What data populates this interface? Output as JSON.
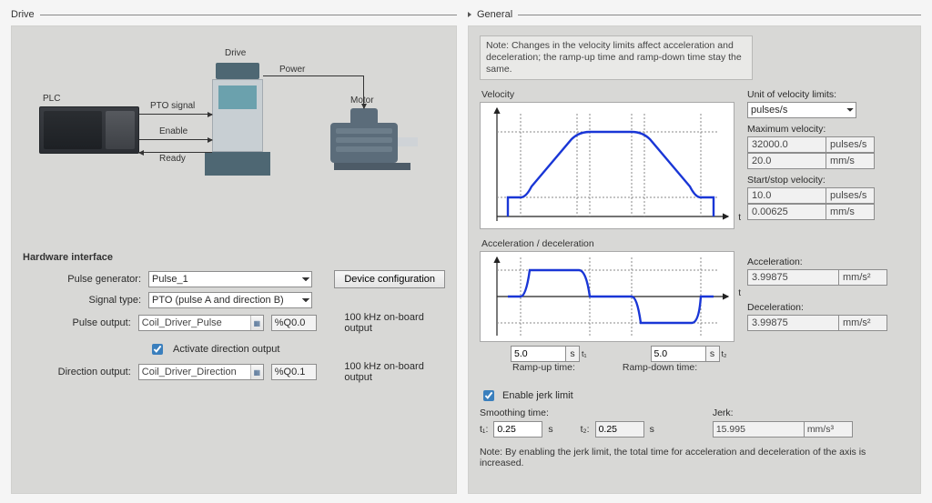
{
  "left": {
    "section_title": "Drive",
    "diagram": {
      "plc": "PLC",
      "drive": "Drive",
      "motor": "Motor",
      "pto": "PTO signal",
      "enable": "Enable",
      "ready": "Ready",
      "power": "Power"
    },
    "hw_title": "Hardware interface",
    "labels": {
      "pulse_gen": "Pulse generator:",
      "signal_type": "Signal type:",
      "pulse_output": "Pulse output:",
      "activate_dir": "Activate direction output",
      "dir_output": "Direction output:",
      "freq_note": "100 kHz on-board output"
    },
    "values": {
      "pulse_gen": "Pulse_1",
      "signal_type": "PTO (pulse A and direction B)",
      "pulse_output_name": "Coil_Driver_Pulse",
      "pulse_output_addr": "%Q0.0",
      "dir_output_name": "Coil_Driver_Direction",
      "dir_output_addr": "%Q0.1",
      "device_cfg_btn": "Device configuration"
    }
  },
  "right": {
    "section_title": "General",
    "note": "Note: Changes in the velocity limits affect acceleration and deceleration; the ramp-up time and ramp-down time stay the same.",
    "labels": {
      "velocity": "Velocity",
      "accel_decel": "Acceleration / deceleration",
      "unit_vel": "Unit of velocity limits:",
      "max_vel": "Maximum velocity:",
      "start_stop": "Start/stop velocity:",
      "accel": "Acceleration:",
      "decel": "Deceleration:",
      "ramp_up": "Ramp-up time:",
      "ramp_down": "Ramp-down time:",
      "enable_jerk": "Enable jerk limit",
      "smoothing": "Smoothing time:",
      "jerk": "Jerk:",
      "t1": "t₁:",
      "t2": "t₂:",
      "axis_t": "t"
    },
    "units": {
      "pulses_s": "pulses/s",
      "mm_s": "mm/s",
      "mm_s2": "mm/s²",
      "mm_s3": "mm/s³",
      "s": "s"
    },
    "values": {
      "unit_vel": "pulses/s",
      "max_vel_pulses": "32000.0",
      "max_vel_mm": "20.0",
      "start_stop_pulses": "10.0",
      "start_stop_mm": "0.00625",
      "accel": "3.99875",
      "decel": "3.99875",
      "ramp_up": "5.0",
      "ramp_down": "5.0",
      "t1": "0.25",
      "t2": "0.25",
      "jerk": "15.995"
    },
    "note2": "Note: By enabling the jerk limit, the total time for acceleration and deceleration of the axis is increased."
  },
  "chart_data": [
    {
      "type": "line",
      "title": "Velocity",
      "xlabel": "t",
      "ylabel": "Velocity",
      "x": [
        0,
        0.5,
        0.75,
        4.75,
        5.0,
        10.0,
        10.25,
        14.25,
        14.5,
        15.0
      ],
      "values": [
        0,
        10,
        10,
        32000,
        32000,
        32000,
        32000,
        10,
        10,
        0
      ],
      "annotations": [
        "ramp-up 5.0 s",
        "ramp-down 5.0 s"
      ]
    },
    {
      "type": "line",
      "title": "Acceleration / deceleration",
      "xlabel": "t",
      "ylabel": "",
      "x": [
        0,
        0.75,
        1.0,
        4.5,
        4.75,
        10.25,
        10.5,
        14.0,
        14.25,
        15.0
      ],
      "values": [
        0,
        0,
        3.99875,
        3.99875,
        0,
        0,
        -3.99875,
        -3.99875,
        0,
        0
      ],
      "ylim": [
        -4,
        4
      ]
    }
  ]
}
